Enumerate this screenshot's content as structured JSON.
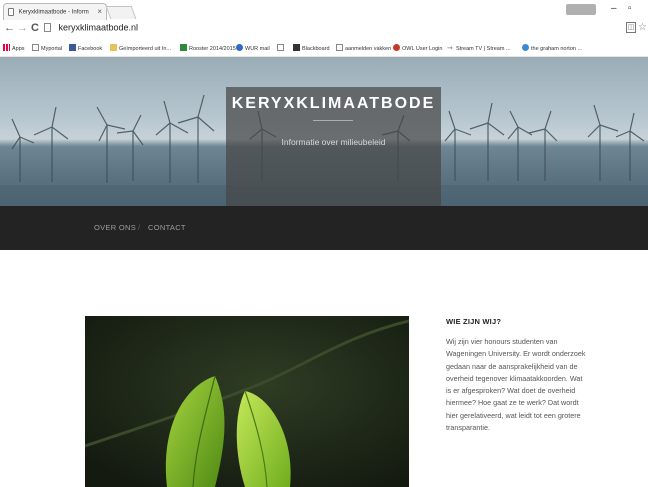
{
  "browser": {
    "tab_title": "Keryxklimaatbode - Inform",
    "tab_close": "×",
    "user_badge": "",
    "url": "keryxklimaatbode.nl",
    "nav": {
      "back": "←",
      "forward": "→",
      "reload": "C"
    },
    "bookmarks": [
      {
        "label": "Apps",
        "icon": "apps-grid-icon"
      },
      {
        "label": "Myportal",
        "icon": "page-icon"
      },
      {
        "label": "Facebook",
        "icon": "facebook-icon"
      },
      {
        "label": "Geïmporteerd uit In...",
        "icon": "folder-icon"
      },
      {
        "label": "Rooster 2014/2015",
        "icon": "rooster-icon"
      },
      {
        "label": "WUR mail",
        "icon": "wur-icon"
      },
      {
        "label": "",
        "icon": "page-icon"
      },
      {
        "label": "Blackboard",
        "icon": "blackboard-icon"
      },
      {
        "label": "aanmelden vakken",
        "icon": "page-icon"
      },
      {
        "label": "OWL User Login",
        "icon": "owl-icon"
      },
      {
        "label": "Stream TV | Stream ...",
        "icon": "stream-icon"
      },
      {
        "label": "the graham norton ...",
        "icon": "globe-icon"
      }
    ]
  },
  "site": {
    "title": "KERYXKLIMAATBODE",
    "tagline": "Informatie over milieubeleid",
    "nav": {
      "over_ons": "OVER ONS",
      "separator": "/",
      "contact": "CONTACT"
    }
  },
  "sidebar": {
    "title": "WIE ZIJN WIJ?",
    "text": "Wij zijn vier honours studenten van Wageningen University. Er wordt onderzoek gedaan naar de aansprakelijkheid van de overheid tegenover klimaatakkoorden. Wat is er afgesproken? Wat doet de overheid hiermee? Hoe gaat ze te werk? Dat wordt hier gerelativeerd, wat leidt tot een grotere transparantie."
  },
  "colors": {
    "navbar": "#232323",
    "brand_box": "#464646",
    "leaf": "#7fb52a"
  }
}
